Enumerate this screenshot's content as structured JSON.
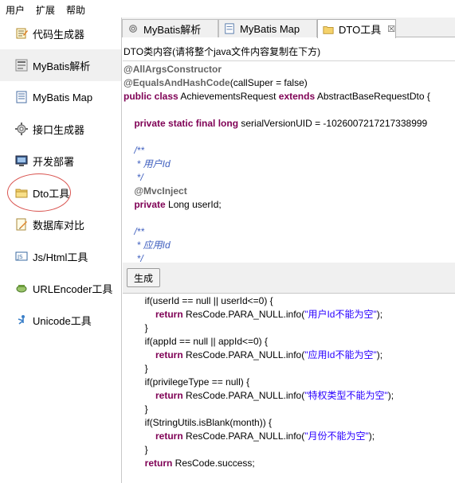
{
  "menubar": {
    "items": [
      "用户",
      "扩展",
      "帮助"
    ]
  },
  "sidebar": {
    "items": [
      {
        "label": "代码生成器",
        "icon": "code-generator-icon",
        "active": false
      },
      {
        "label": "MyBatis解析",
        "icon": "mybatis-parse-icon",
        "active": true
      },
      {
        "label": "MyBatis Map",
        "icon": "mybatis-map-icon",
        "active": false
      },
      {
        "label": "接口生成器",
        "icon": "interface-generator-icon",
        "active": false
      },
      {
        "label": "开发部署",
        "icon": "deploy-icon",
        "active": false
      },
      {
        "label": "Dto工具",
        "icon": "dto-tool-icon",
        "active": false,
        "highlighted": true
      },
      {
        "label": "数据库对比",
        "icon": "database-compare-icon",
        "active": false
      },
      {
        "label": "Js/Html工具",
        "icon": "js-html-icon",
        "active": false
      },
      {
        "label": "URLEncoder工具",
        "icon": "url-encoder-icon",
        "active": false
      },
      {
        "label": "Unicode工具",
        "icon": "unicode-icon",
        "active": false
      }
    ],
    "highlight_color": "#d9534f"
  },
  "tabs": [
    {
      "label": "MyBatis解析",
      "icon": "mybatis-parse-icon",
      "active": false,
      "closable": false
    },
    {
      "label": "MyBatis Map",
      "icon": "mybatis-map-icon",
      "active": false,
      "closable": false
    },
    {
      "label": "DTO工具",
      "icon": "dto-tool-icon",
      "active": true,
      "closable": true,
      "close_glyph": "☒"
    }
  ],
  "dto": {
    "input_label": "DTO类内容(请将整个java文件内容复制在下方)",
    "generate_label": "生成",
    "input_lines": [
      [
        {
          "t": "@AllArgsConstructor",
          "c": "anno"
        }
      ],
      [
        {
          "t": "@EqualsAndHashCode",
          "c": "anno"
        },
        {
          "t": "(callSuper = false)",
          "c": ""
        }
      ],
      [
        {
          "t": "public class",
          "c": "kw"
        },
        {
          "t": " AchievementsRequest ",
          "c": ""
        },
        {
          "t": "extends",
          "c": "kw"
        },
        {
          "t": " AbstractBaseRequestDto {",
          "c": ""
        }
      ],
      [],
      [
        {
          "t": "    ",
          "c": ""
        },
        {
          "t": "private static final long",
          "c": "kw"
        },
        {
          "t": " serialVersionUID = -1026007217217338999",
          "c": ""
        }
      ],
      [],
      [
        {
          "t": "    /**",
          "c": "comment"
        }
      ],
      [
        {
          "t": "     * 用户Id",
          "c": "comment"
        }
      ],
      [
        {
          "t": "     */",
          "c": "comment"
        }
      ],
      [
        {
          "t": "    ",
          "c": ""
        },
        {
          "t": "@MvcInject",
          "c": "anno"
        }
      ],
      [
        {
          "t": "    ",
          "c": ""
        },
        {
          "t": "private",
          "c": "kw"
        },
        {
          "t": " Long userId;",
          "c": ""
        }
      ],
      [],
      [
        {
          "t": "    /**",
          "c": "comment"
        }
      ],
      [
        {
          "t": "     * 应用Id",
          "c": "comment"
        }
      ],
      [
        {
          "t": "     */",
          "c": "comment"
        }
      ]
    ],
    "output_lines": [
      [
        {
          "t": "        if(userId == null || userId<=0) {",
          "c": ""
        }
      ],
      [
        {
          "t": "            ",
          "c": ""
        },
        {
          "t": "return",
          "c": "kw"
        },
        {
          "t": " ResCode.PARA_NULL.info(",
          "c": ""
        },
        {
          "t": "\"用户Id不能为空\"",
          "c": "str"
        },
        {
          "t": ");",
          "c": ""
        }
      ],
      [
        {
          "t": "        }",
          "c": ""
        }
      ],
      [
        {
          "t": "        if(appId == null || appId<=0) {",
          "c": ""
        }
      ],
      [
        {
          "t": "            ",
          "c": ""
        },
        {
          "t": "return",
          "c": "kw"
        },
        {
          "t": " ResCode.PARA_NULL.info(",
          "c": ""
        },
        {
          "t": "\"应用Id不能为空\"",
          "c": "str"
        },
        {
          "t": ");",
          "c": ""
        }
      ],
      [
        {
          "t": "        }",
          "c": ""
        }
      ],
      [
        {
          "t": "        if(privilegeType == null) {",
          "c": ""
        }
      ],
      [
        {
          "t": "            ",
          "c": ""
        },
        {
          "t": "return",
          "c": "kw"
        },
        {
          "t": " ResCode.PARA_NULL.info(",
          "c": ""
        },
        {
          "t": "\"特权类型不能为空\"",
          "c": "str"
        },
        {
          "t": ");",
          "c": ""
        }
      ],
      [
        {
          "t": "        }",
          "c": ""
        }
      ],
      [
        {
          "t": "        if(StringUtils.isBlank(month)) {",
          "c": ""
        }
      ],
      [
        {
          "t": "            ",
          "c": ""
        },
        {
          "t": "return",
          "c": "kw"
        },
        {
          "t": " ResCode.PARA_NULL.info(",
          "c": ""
        },
        {
          "t": "\"月份不能为空\"",
          "c": "str"
        },
        {
          "t": ");",
          "c": ""
        }
      ],
      [
        {
          "t": "        }",
          "c": ""
        }
      ],
      [
        {
          "t": "        ",
          "c": ""
        },
        {
          "t": "return",
          "c": "kw"
        },
        {
          "t": " ResCode.success;",
          "c": ""
        }
      ]
    ]
  }
}
